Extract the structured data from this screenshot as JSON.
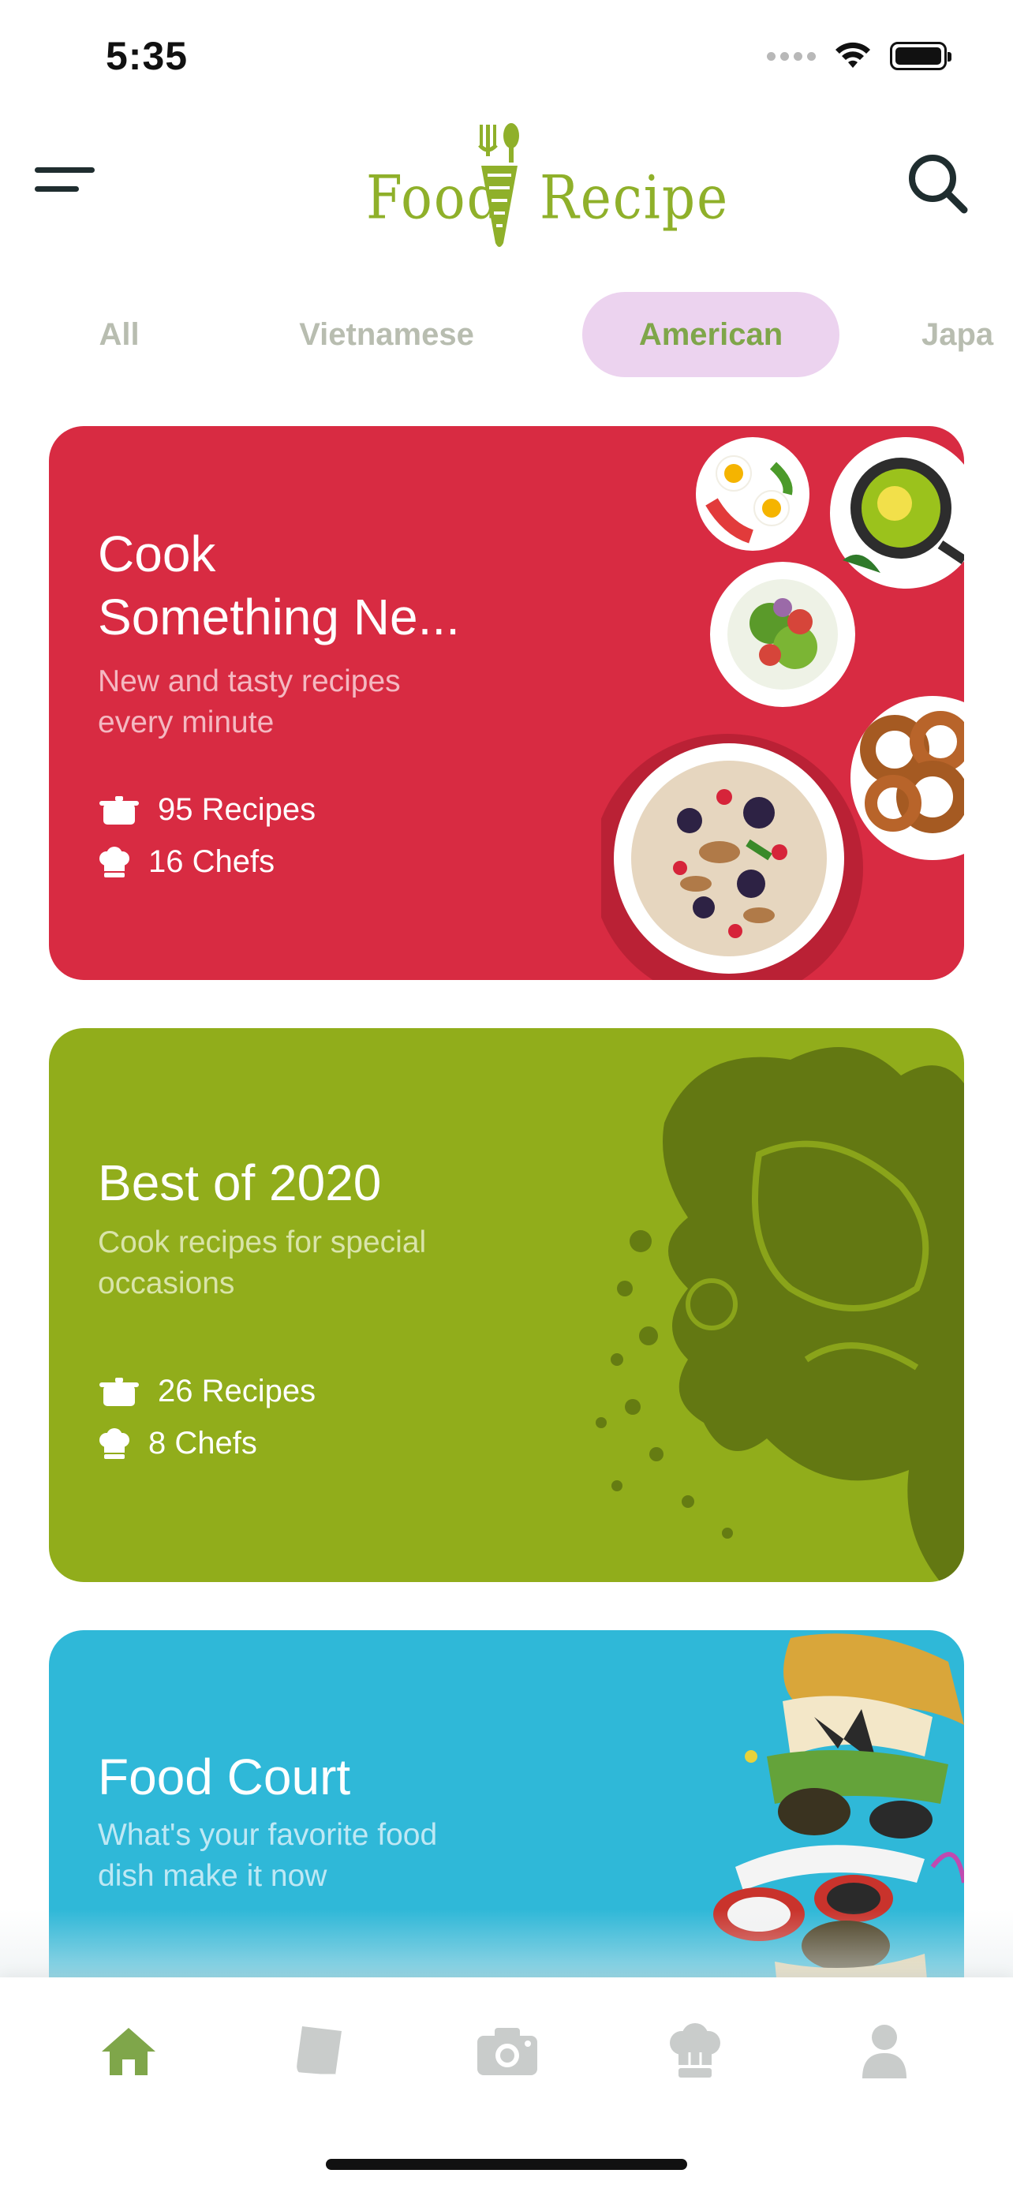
{
  "status_bar": {
    "time": "5:35"
  },
  "header": {
    "logo_word_left": "Food",
    "logo_word_right": "Recipe"
  },
  "tabs": [
    {
      "label": "All",
      "active": false
    },
    {
      "label": "Vietnamese",
      "active": false
    },
    {
      "label": "American",
      "active": true
    },
    {
      "label": "Japa",
      "active": false
    }
  ],
  "cards": [
    {
      "title": "Cook\nSomething Ne...",
      "subtitle": "New and tasty recipes\nevery minute",
      "recipes": "95 Recipes",
      "chefs": "16 Chefs",
      "color": "#d82b42"
    },
    {
      "title": "Best of 2020",
      "subtitle": "Cook recipes for special\noccasions",
      "recipes": "26 Recipes",
      "chefs": "8 Chefs",
      "color": "#91ad1b"
    },
    {
      "title": "Food Court",
      "subtitle": "What's your favorite food\ndish make it now",
      "color": "#2fb8d8"
    }
  ],
  "bottom_nav": [
    {
      "icon": "home-icon",
      "active": true
    },
    {
      "icon": "recipe-book-icon",
      "active": false
    },
    {
      "icon": "camera-icon",
      "active": false
    },
    {
      "icon": "chef-hat-icon",
      "active": false
    },
    {
      "icon": "profile-icon",
      "active": false
    }
  ],
  "colors": {
    "accent_green": "#7fa64a",
    "tab_active_bg": "#ecd3ef",
    "tab_inactive": "#b8bdb0",
    "nav_inactive": "#c9cccb"
  }
}
